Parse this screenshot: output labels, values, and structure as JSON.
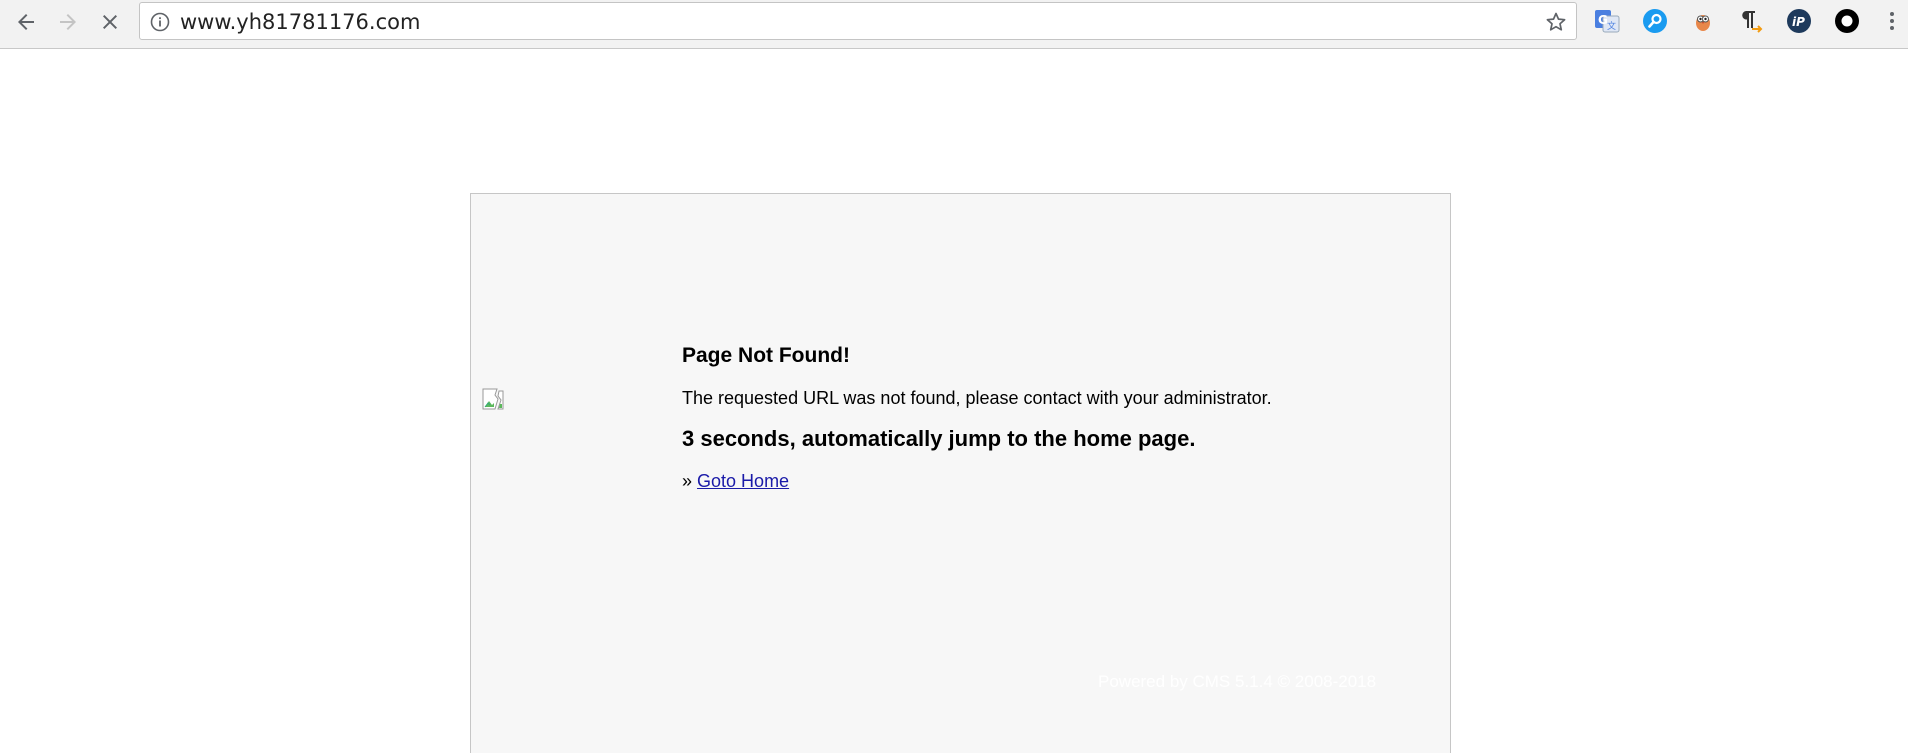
{
  "browser": {
    "url": "www.yh81781176.com",
    "extensions": [
      "translate-icon",
      "search-icon",
      "bird-icon",
      "paragraph-icon",
      "ip-icon",
      "circle-icon"
    ]
  },
  "page": {
    "title": "Page Not Found!",
    "message": "The requested URL was not found, please contact with your administrator.",
    "jump_text": "3 seconds, automatically jump to the home page.",
    "goto_prefix": "»",
    "goto_label": "Goto Home",
    "powered_by": "Powered by CMS 5.1.4 © 2008-2018"
  }
}
